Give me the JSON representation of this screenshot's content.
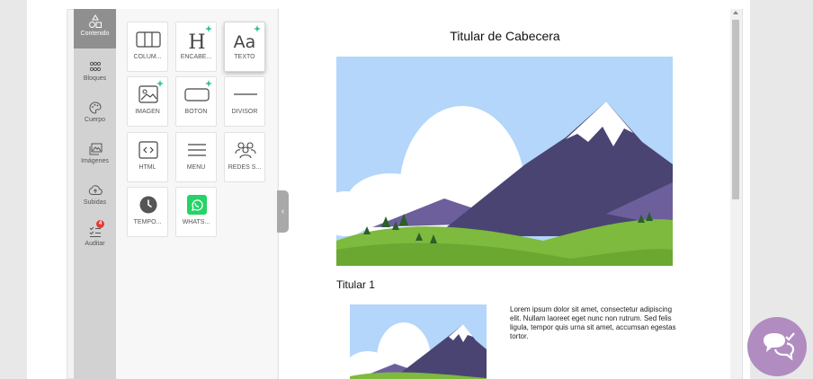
{
  "sidebar": {
    "items": [
      {
        "label": "Contenido",
        "icon": "shapes-icon",
        "active": true
      },
      {
        "label": "Bloques",
        "icon": "grid-dots-icon"
      },
      {
        "label": "Cuerpo",
        "icon": "palette-icon"
      },
      {
        "label": "Imágenes",
        "icon": "images-icon"
      },
      {
        "label": "Subidas",
        "icon": "cloud-upload-icon"
      },
      {
        "label": "Auditar",
        "icon": "checklist-icon",
        "badge": "4"
      }
    ]
  },
  "tools": [
    {
      "label": "COLUM...",
      "icon": "columns-icon"
    },
    {
      "label": "ENCABE...",
      "icon": "heading-icon",
      "sparkle": true
    },
    {
      "label": "TEXTO",
      "icon": "text-icon",
      "sparkle": true,
      "selected": true
    },
    {
      "label": "IMAGEN",
      "icon": "image-icon",
      "sparkle": true
    },
    {
      "label": "BOTÓN",
      "icon": "button-icon",
      "sparkle": true
    },
    {
      "label": "DIVISOR",
      "icon": "divider-icon"
    },
    {
      "label": "HTML",
      "icon": "code-icon"
    },
    {
      "label": "MENÚ",
      "icon": "menu-icon"
    },
    {
      "label": "REDES S...",
      "icon": "social-icon"
    },
    {
      "label": "TEMPO...",
      "icon": "clock-icon"
    },
    {
      "label": "WHATS...",
      "icon": "whatsapp-icon"
    }
  ],
  "canvas": {
    "header_title": "Titular de Cabecera",
    "section_title": "Titular 1",
    "body_text": "Lorem ipsum dolor sit amet, consectetur adipiscing elit. Nullam laoreet eget nunc non rutrum. Sed felis ligula, tempor quis urna sit amet, accumsan egestas tortor."
  },
  "colors": {
    "sky": "#b3d6fa",
    "mountain": "#4a4473",
    "grass": "#7dba3d",
    "sparkle": "#2bbf8f",
    "whatsapp": "#25d366",
    "chat": "#b18cc0",
    "badge": "#e53935"
  }
}
